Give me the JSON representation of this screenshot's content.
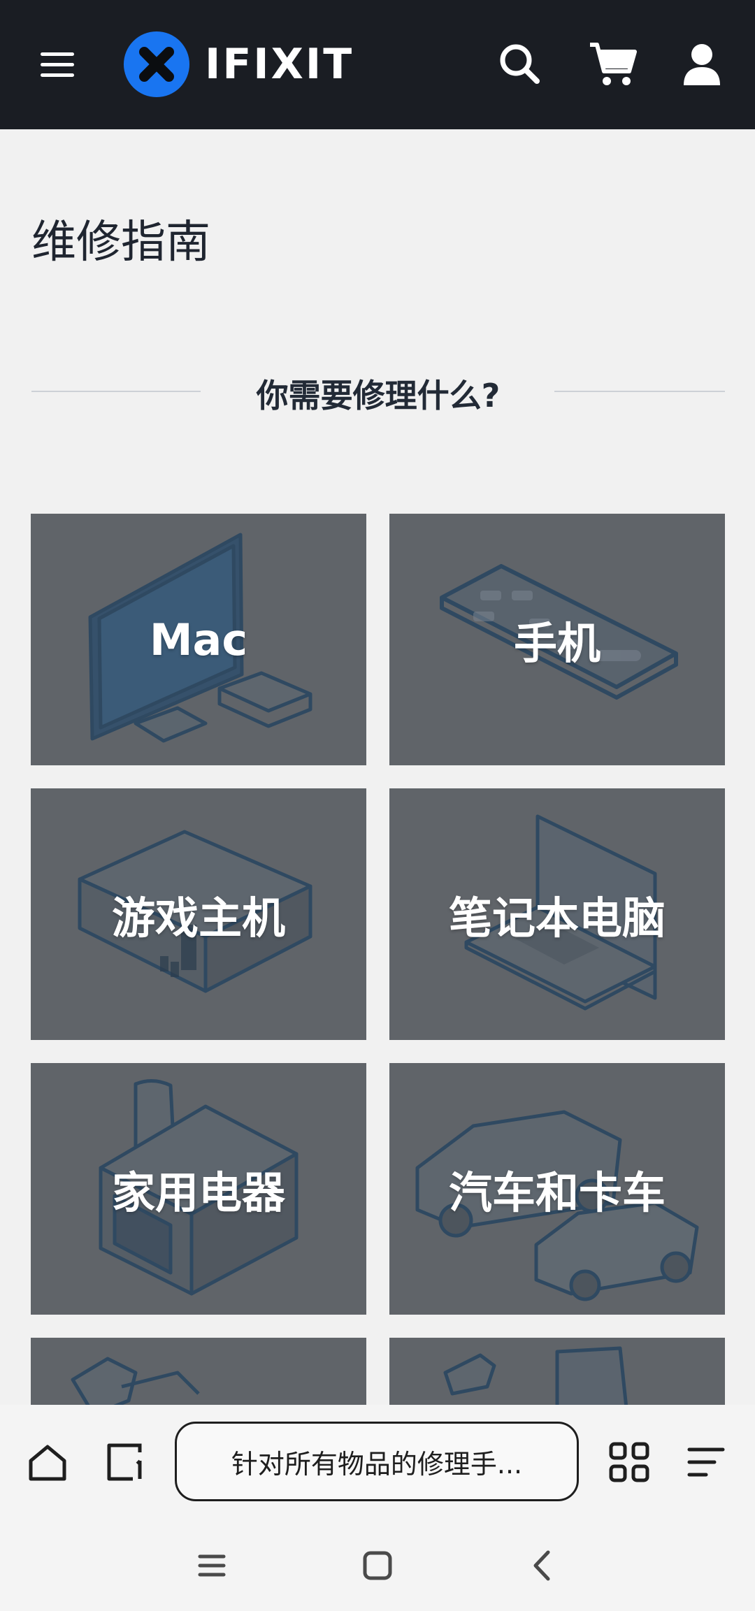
{
  "header": {
    "brand": "IFIXIT",
    "icons": [
      "menu-icon",
      "ifixit-logo",
      "search-icon",
      "cart-icon",
      "user-icon"
    ],
    "colors": {
      "background": "#1a1d23",
      "brand_blue": "#1975f1"
    }
  },
  "page": {
    "title": "维修指南",
    "section_heading": "你需要修理什么?"
  },
  "categories": [
    {
      "label": "Mac",
      "icon": "imac-macmini-icon"
    },
    {
      "label": "手机",
      "icon": "phone-icon"
    },
    {
      "label": "游戏主机",
      "icon": "game-console-icon"
    },
    {
      "label": "笔记本电脑",
      "icon": "laptop-icon"
    },
    {
      "label": "家用电器",
      "icon": "appliance-icon"
    },
    {
      "label": "汽车和卡车",
      "icon": "car-truck-icon"
    },
    {
      "label": "",
      "icon": "tools-icon"
    },
    {
      "label": "",
      "icon": "camera-icon"
    }
  ],
  "browser_toolbar": {
    "url_text": "针对所有物品的修理手...",
    "icons": [
      "home-icon",
      "tabs-icon",
      "apps-icon",
      "menu-lines-icon"
    ]
  },
  "system_nav": {
    "icons": [
      "recent-apps-icon",
      "home-square-icon",
      "back-chevron-icon"
    ]
  }
}
